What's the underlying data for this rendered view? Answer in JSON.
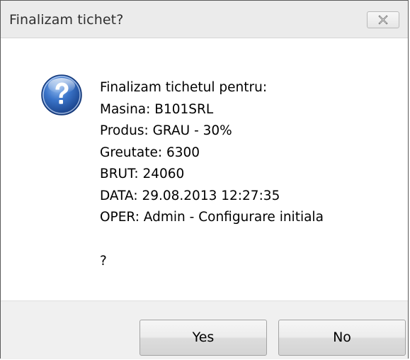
{
  "dialog": {
    "title": "Finalizam tichet?",
    "close_icon": "close-icon",
    "icon": "question-icon",
    "message_lines": [
      "Finalizam tichetul pentru:",
      "Masina: B101SRL",
      "Produs: GRAU - 30%",
      "Greutate: 6300",
      "BRUT: 24060",
      "DATA: 29.08.2013 12:27:35",
      "OPER: Admin - Configurare initiala"
    ],
    "question_mark": "?",
    "buttons": {
      "yes_label": "Yes",
      "no_label": "No"
    }
  },
  "colors": {
    "icon_blue": "#2a5fb0",
    "titlebar_bg": "#ebebeb",
    "footer_bg": "#f0f0f0"
  }
}
